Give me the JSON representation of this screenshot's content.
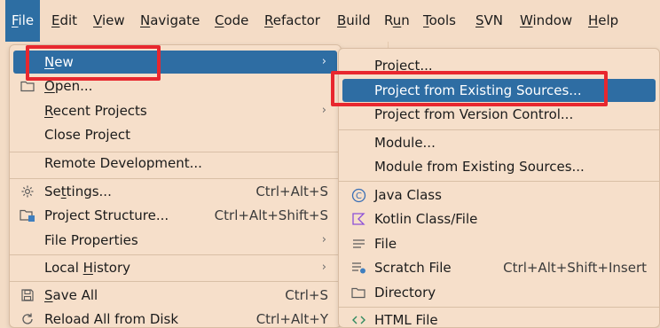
{
  "menubar": {
    "items": [
      {
        "pre": "",
        "u": "F",
        "post": "ile"
      },
      {
        "pre": "",
        "u": "E",
        "post": "dit"
      },
      {
        "pre": "",
        "u": "V",
        "post": "iew"
      },
      {
        "pre": "",
        "u": "N",
        "post": "avigate"
      },
      {
        "pre": "",
        "u": "C",
        "post": "ode"
      },
      {
        "pre": "",
        "u": "R",
        "post": "efactor"
      },
      {
        "pre": "",
        "u": "B",
        "post": "uild"
      },
      {
        "pre": "R",
        "u": "u",
        "post": "n"
      },
      {
        "pre": "",
        "u": "T",
        "post": "ools"
      },
      {
        "pre": "",
        "u": "S",
        "post": "VN"
      },
      {
        "pre": "",
        "u": "W",
        "post": "indow"
      },
      {
        "pre": "",
        "u": "H",
        "post": "elp"
      }
    ]
  },
  "file_menu": {
    "new": {
      "u": "N",
      "post": "ew"
    },
    "open": {
      "u": "O",
      "post": "pen..."
    },
    "recent": {
      "u": "R",
      "post": "ecent Projects"
    },
    "close_project": "Close Project",
    "remote_dev": "Remote Development...",
    "settings": {
      "pre": "Se",
      "u": "t",
      "post": "tings...",
      "shortcut": "Ctrl+Alt+S"
    },
    "project_structure": {
      "label": "Project Structure...",
      "shortcut": "Ctrl+Alt+Shift+S"
    },
    "file_properties": "File Properties",
    "local_history": {
      "pre": "Local ",
      "u": "H",
      "post": "istory"
    },
    "save_all": {
      "u": "S",
      "post": "ave All",
      "shortcut": "Ctrl+S"
    },
    "reload_all": {
      "label": "Reload All from Disk",
      "shortcut": "Ctrl+Alt+Y"
    }
  },
  "new_submenu": {
    "project": "Project...",
    "project_existing": "Project from Existing Sources...",
    "project_vcs": "Project from Version Control...",
    "module": "Module...",
    "module_existing": "Module from Existing Sources...",
    "java_class": "Java Class",
    "kotlin_class": "Kotlin Class/File",
    "file": "File",
    "scratch_file": {
      "label": "Scratch File",
      "shortcut": "Ctrl+Alt+Shift+Insert"
    },
    "directory": "Directory",
    "html_file": "HTML File"
  },
  "icons": {
    "submenu_arrow": "›",
    "java_class_glyph": "C"
  },
  "colors": {
    "selection": "#2e6da3",
    "highlight": "#e8272e",
    "background": "#f3dcc6"
  }
}
